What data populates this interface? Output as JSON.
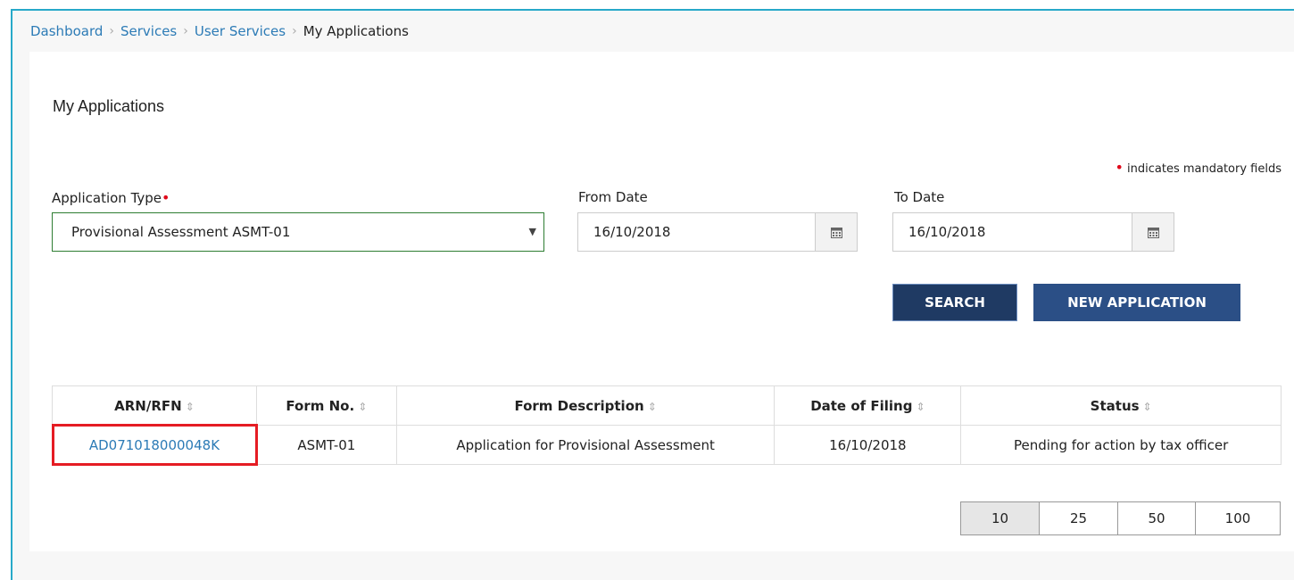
{
  "breadcrumb": {
    "items": [
      "Dashboard",
      "Services",
      "User Services"
    ],
    "current": "My Applications"
  },
  "page_title": "My Applications",
  "mandatory_note": "indicates mandatory fields",
  "form": {
    "application_type": {
      "label": "Application Type",
      "value": "Provisional Assessment ASMT-01"
    },
    "from_date": {
      "label": "From Date",
      "value": "16/10/2018"
    },
    "to_date": {
      "label": "To Date",
      "value": "16/10/2018"
    }
  },
  "buttons": {
    "search": "SEARCH",
    "new_application": "NEW APPLICATION"
  },
  "table": {
    "headers": [
      "ARN/RFN",
      "Form No.",
      "Form Description",
      "Date of Filing",
      "Status"
    ],
    "rows": [
      [
        "AD071018000048K",
        "ASMT-01",
        "Application for Provisional Assessment",
        "16/10/2018",
        "Pending for action by tax officer"
      ]
    ]
  },
  "pagination": {
    "options": [
      "10",
      "25",
      "50",
      "100"
    ],
    "selected": "10"
  },
  "colors": {
    "accent": "#27a9c9",
    "link": "#2c7bb6",
    "button_dark": "#1f3a63",
    "button": "#2b4f86",
    "highlight": "#e51c23",
    "mandatory": "#e0091b"
  },
  "icons": {
    "calendar": "calendar-icon",
    "caret": "chevron-down-icon",
    "sort": "sort-icon"
  }
}
